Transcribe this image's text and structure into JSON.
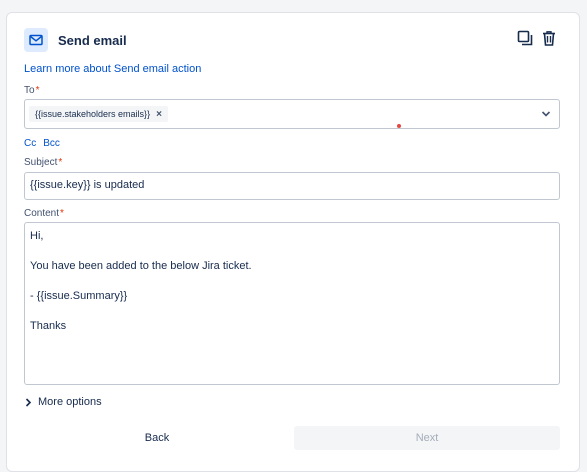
{
  "action": {
    "title": "Send email",
    "icon": "mail-icon",
    "learn_more_link": "Learn more about Send email action",
    "copy_icon": "copy-icon",
    "delete_icon": "trash-icon"
  },
  "form": {
    "to": {
      "label": "To",
      "required_marker": "*",
      "chips": [
        "{{issue.stakeholders emails}}"
      ],
      "chip_remove": "×"
    },
    "cc_label": "Cc",
    "bcc_label": "Bcc",
    "subject": {
      "label": "Subject",
      "required_marker": "*",
      "value": "{{issue.key}} is updated"
    },
    "content": {
      "label": "Content",
      "required_marker": "*",
      "lines": [
        "Hi,",
        "You have been added to the below Jira ticket.",
        "- {{issue.Summary}}",
        "Thanks"
      ]
    },
    "more_options_label": "More options"
  },
  "buttons": {
    "back": "Back",
    "next": "Next"
  },
  "colors": {
    "link": "#0052cc",
    "required": "#de350b",
    "icon_badge_bg": "#deebff"
  }
}
